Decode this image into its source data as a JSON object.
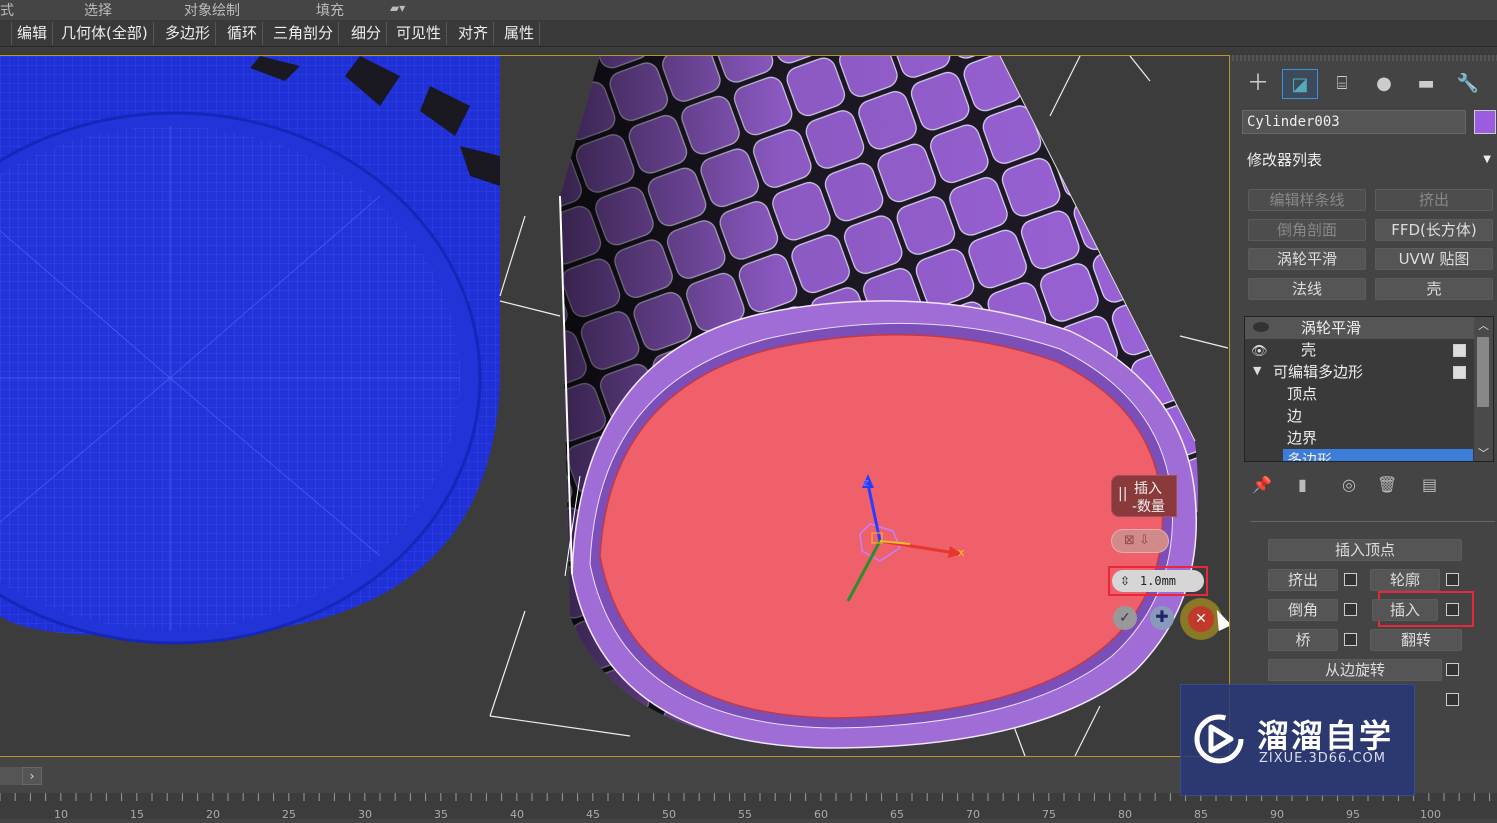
{
  "top_menu": {
    "items": [
      "式",
      "选择",
      "对象绘制",
      "填充"
    ]
  },
  "ribbon": {
    "items": [
      "编辑",
      "几何体(全部)",
      "多边形",
      "循环",
      "三角剖分",
      "细分",
      "可见性",
      "对齐",
      "属性"
    ]
  },
  "viewport": {
    "caddy_title": "插入",
    "caddy_sub": "-数量",
    "caddy_value": "1.0mm",
    "gizmo_z": "z",
    "gizmo_x": "x"
  },
  "panel": {
    "object_name": "Cylinder003",
    "modifier_list": "修改器列表",
    "modifier_buttons": [
      "编辑样条线",
      "挤出",
      "倒角剖面",
      "FFD(长方体)",
      "涡轮平滑",
      "UVW 贴图",
      "法线",
      "壳"
    ],
    "stack": [
      "涡轮平滑",
      "壳",
      "可编辑多边形",
      "顶点",
      "边",
      "边界",
      "多边形"
    ],
    "edit_poly": {
      "insert_vertex": "插入顶点",
      "extrude": "挤出",
      "outline": "轮廓",
      "bevel": "倒角",
      "inset": "插入",
      "bridge": "桥",
      "flip": "翻转",
      "hinge": "从边旋转"
    }
  },
  "watermark": {
    "title": "溜溜自学",
    "url": "ZIXUE.3D66.COM"
  },
  "ruler": {
    "ticks": [
      "10",
      "15",
      "20",
      "25",
      "30",
      "35",
      "40",
      "45",
      "50",
      "55",
      "60",
      "65",
      "70",
      "75",
      "80",
      "85",
      "90",
      "95",
      "100"
    ]
  },
  "colors": {
    "accent_red": "#e8283a",
    "selection_face": "#f0606b",
    "poly_purple": "#9b63d8",
    "wire_blue": "#1f31d6",
    "viewport_border": "#b8972a"
  }
}
